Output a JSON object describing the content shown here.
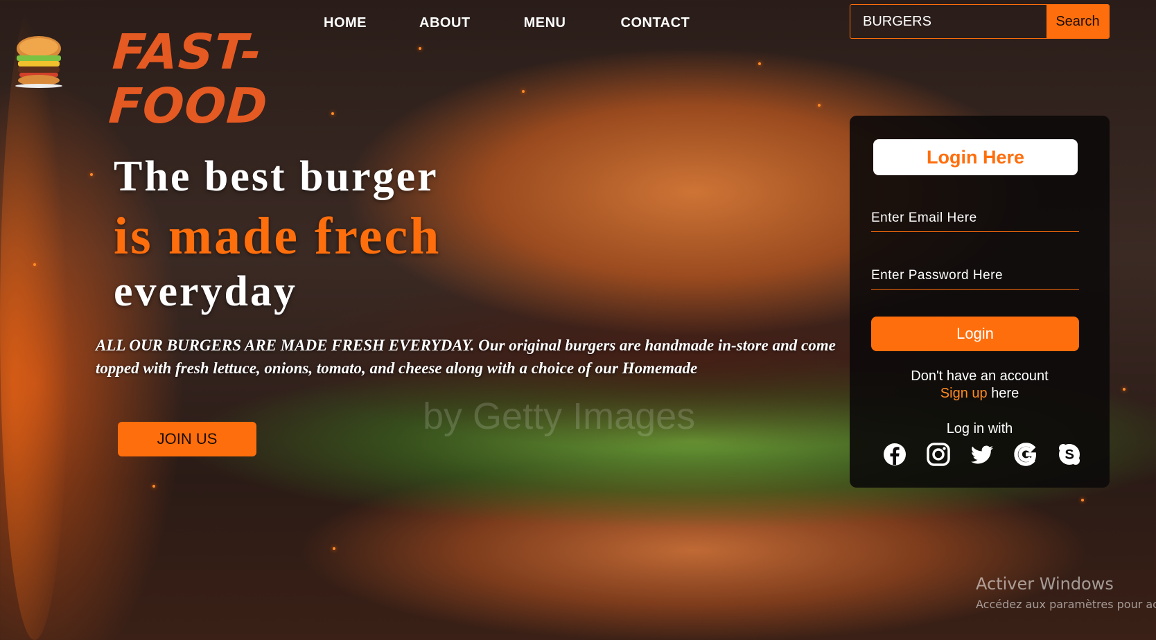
{
  "brand": {
    "line1": "FAST-",
    "line2": "FOOD"
  },
  "nav": {
    "home": "HOME",
    "about": "ABOUT",
    "menu": "MENU",
    "contact": "CONTACT"
  },
  "search": {
    "value": "BURGERS",
    "button": "Search"
  },
  "hero": {
    "line1": "The best burger",
    "line2": "is made frech",
    "line3": "everyday",
    "description": "ALL OUR BURGERS ARE MADE FRESH EVERYDAY. Our original burgers are handmade in-store and come topped with fresh lettuce, onions, tomato, and cheese along with a choice of our Homemade",
    "join_button": "JOIN US"
  },
  "image_watermark": "by Getty Images",
  "login": {
    "title": "Login Here",
    "email_placeholder": "Enter Email Here",
    "password_placeholder": "Enter Password Here",
    "button": "Login",
    "no_account": "Don't have an account",
    "signup_link": "Sign up",
    "signup_suffix": "here",
    "login_with": "Log in with",
    "socials": [
      "facebook-icon",
      "instagram-icon",
      "twitter-icon",
      "google-icon",
      "skype-icon"
    ]
  },
  "windows_activation": {
    "title": "Activer Windows",
    "subtitle": "Accédez aux paramètres pour act"
  },
  "colors": {
    "accent": "#ff6e0c",
    "brand": "#e55a22",
    "panel": "#0c0a0a"
  }
}
